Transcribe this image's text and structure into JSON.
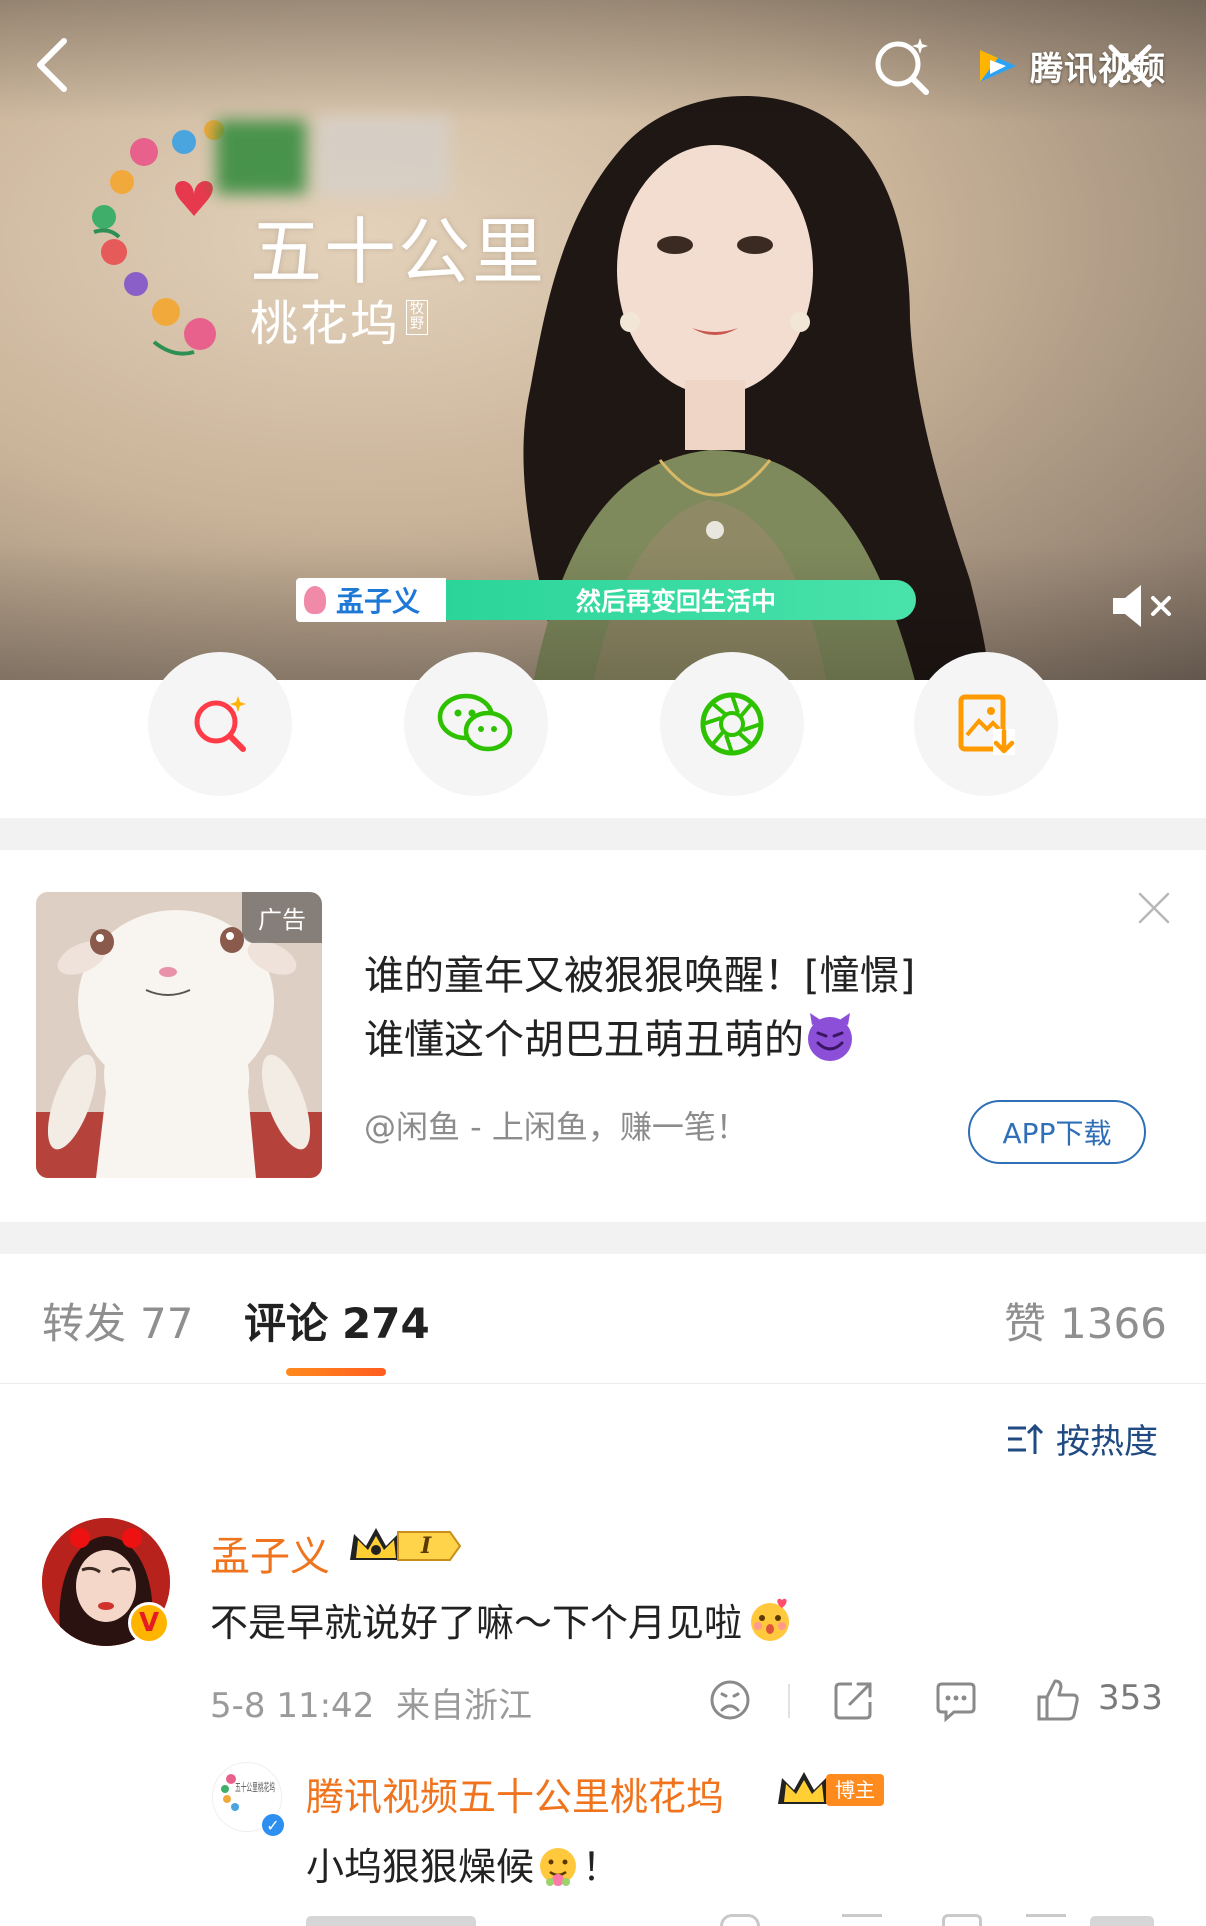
{
  "video": {
    "brand": "腾讯视频",
    "show_title": "五十公里",
    "show_subtitle": "桃花坞",
    "show_subtitle_tag": "牧野",
    "caption_name": "孟子义",
    "caption_line": "然后再变回生活中"
  },
  "share": {
    "items": [
      {
        "icon": "search-icon",
        "color": "#ff4d4f"
      },
      {
        "icon": "wechat-icon",
        "color": "#2dc100"
      },
      {
        "icon": "moments-icon",
        "color": "#2dc100"
      },
      {
        "icon": "save-image-icon",
        "color": "#ff9a00"
      }
    ]
  },
  "ad": {
    "tag": "广告",
    "title_line1": "谁的童年又被狠狠唤醒！[憧憬]",
    "title_line2": "谁懂这个胡巴丑萌丑萌的",
    "title_emoji": "smiling-devil-emoji",
    "source": "@闲鱼 - 上闲鱼，赚一笔！",
    "button": "APP下载"
  },
  "tabs": {
    "repost_label": "转发",
    "repost_count": "77",
    "comment_label": "评论",
    "comment_count": "274",
    "like_label": "赞",
    "like_count": "1366",
    "sort_label": "按热度"
  },
  "comment": {
    "username": "孟子义",
    "medal_text": "I",
    "text": "不是早就说好了嘛～下个月见啦",
    "time": "5-8 11:42",
    "location": "来自浙江",
    "likes": "353",
    "reply": {
      "username": "腾讯视频五十公里桃花坞",
      "badge": "博主",
      "avatar_text": "五十公里桃花坞",
      "text": "小坞狠狠燥候",
      "text_suffix": "！"
    }
  },
  "colors": {
    "accent_orange": "#f0741e",
    "link_blue": "#2f6fb8",
    "divider_grey": "#f2f2f2"
  }
}
